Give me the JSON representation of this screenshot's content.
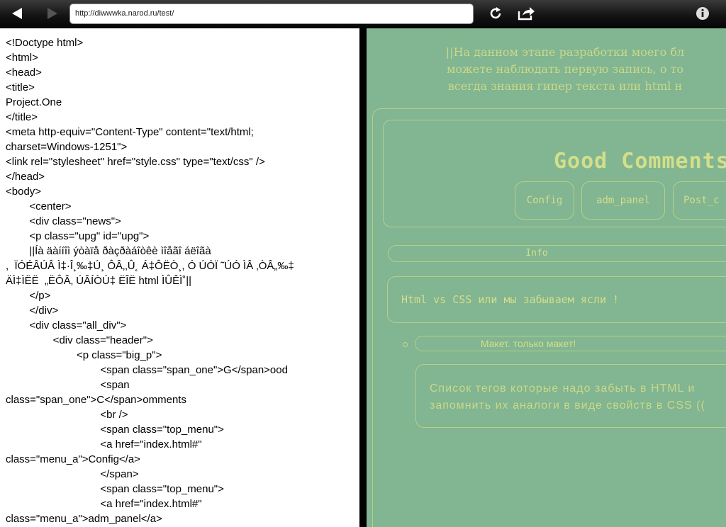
{
  "toolbar": {
    "url": "http://diwwwka.narod.ru/test/"
  },
  "code_lines": [
    "<!Doctype html>",
    "<html>",
    "<head>",
    "<title>",
    "Project.One",
    "</title>",
    "<meta http-equiv=\"Content-Type\" content=\"text/html;",
    "charset=Windows-1251\">",
    "<link rel=\"stylesheet\" href=\"style.css\" type=\"text/css\" />",
    "</head>",
    "<body>",
    "        <center>",
    "        <div class=\"news\">",
    "        <p class=\"upg\" id=\"upg\">",
    "        ||Íà äàííîì ýòàïå ðàçðàáîòêè ìîåãî áëîãà",
    ",  ÏÓÉÂÚÂ Ì‡·Î¸‰‡Ú¸ ÔÂ‚‚Û˛ Á‡ÔËÒ¸, Ó ÚÓÏ ˜ÚÓ ÌÂ ‚ÒÂ„‰‡",
    "ÄÌ‡ÌËË  „ËÔÂ‚ ÚÂÍÒÚ‡ ËÎË html ÌÛÊÌ˚||",
    "        </p>",
    "        </div>",
    "        <div class=\"all_div\">",
    "                <div class=\"header\">",
    "                        <p class=\"big_p\">",
    "                                <span class=\"span_one\">G</span>ood",
    "                                <span",
    "class=\"span_one\">C</span>omments",
    "                                <br />",
    "                                <span class=\"top_menu\">",
    "                                <a href=\"index.html#\"",
    "class=\"menu_a\">Config</a>",
    "                                </span>",
    "                                <span class=\"top_menu\">",
    "                                <a href=\"index.html#\"",
    "class=\"menu_a\">adm_panel</a>"
  ],
  "preview": {
    "intro_lines": [
      "||На данном этапе разработки моего бл",
      "можете наблюдать первую запись, о то",
      "всегда знания гипер текста или html н"
    ],
    "title": "Good Comments",
    "menu": [
      "Config",
      "adm_panel",
      "Post_c"
    ],
    "info_label": "Info",
    "post_title": "Html vs CSS или мы забываем ясли !",
    "sub_label": "Макет. только макет!",
    "sub_text_lines": [
      "Список тегов которые надо забыть в HTML и",
      "запомнить их аналоги в виде свойств в CSS (("
    ]
  },
  "colors": {
    "preview_bg": "#82b591",
    "preview_text": "#c8d989",
    "preview_border": "#b4d08a"
  },
  "icons": {
    "back": "left-triangle-icon",
    "forward": "right-triangle-icon",
    "reload": "reload-icon",
    "share": "share-arrow-icon",
    "info": "info-icon"
  }
}
